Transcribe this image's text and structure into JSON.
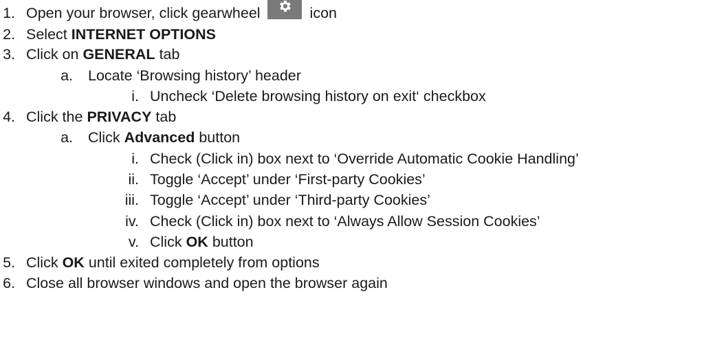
{
  "steps": {
    "s1": {
      "num": "1.",
      "pre": "Open your browser, click gearwheel",
      "post": "icon"
    },
    "s2": {
      "num": "2.",
      "pre": "Select",
      "bold": "INTERNET OPTIONS"
    },
    "s3": {
      "num": "3.",
      "pre": "Click on",
      "bold": "GENERAL",
      "post": "tab"
    },
    "s3a": {
      "num": "a.",
      "text": "Locate ‘Browsing history’ header"
    },
    "s3ai": {
      "num": "i.",
      "text": "Uncheck ‘Delete browsing history on exit‘ checkbox"
    },
    "s4": {
      "num": "4.",
      "pre": "Click the",
      "bold": "PRIVACY",
      "post": "tab"
    },
    "s4a": {
      "num": "a.",
      "pre": "Click",
      "bold": "Advanced",
      "post": "button"
    },
    "s4ai": {
      "num": "i.",
      "text": "Check (Click in) box next to ‘Override Automatic Cookie Handling’"
    },
    "s4aii": {
      "num": "ii.",
      "text": "Toggle ‘Accept’ under ‘First-party Cookies’"
    },
    "s4aiii": {
      "num": "iii.",
      "text": "Toggle ‘Accept’ under ‘Third-party Cookies’"
    },
    "s4aiv": {
      "num": "iv.",
      "text": "Check (Click in) box next to ‘Always Allow Session Cookies’"
    },
    "s4av": {
      "num": "v.",
      "pre": "Click",
      "bold": "OK",
      "post": "button"
    },
    "s5": {
      "num": "5.",
      "pre": "Click",
      "bold": "OK",
      "post": "until exited completely from options"
    },
    "s6": {
      "num": "6.",
      "text": "Close all browser windows and open the browser again"
    }
  },
  "icons": {
    "gear": "gear-icon"
  }
}
